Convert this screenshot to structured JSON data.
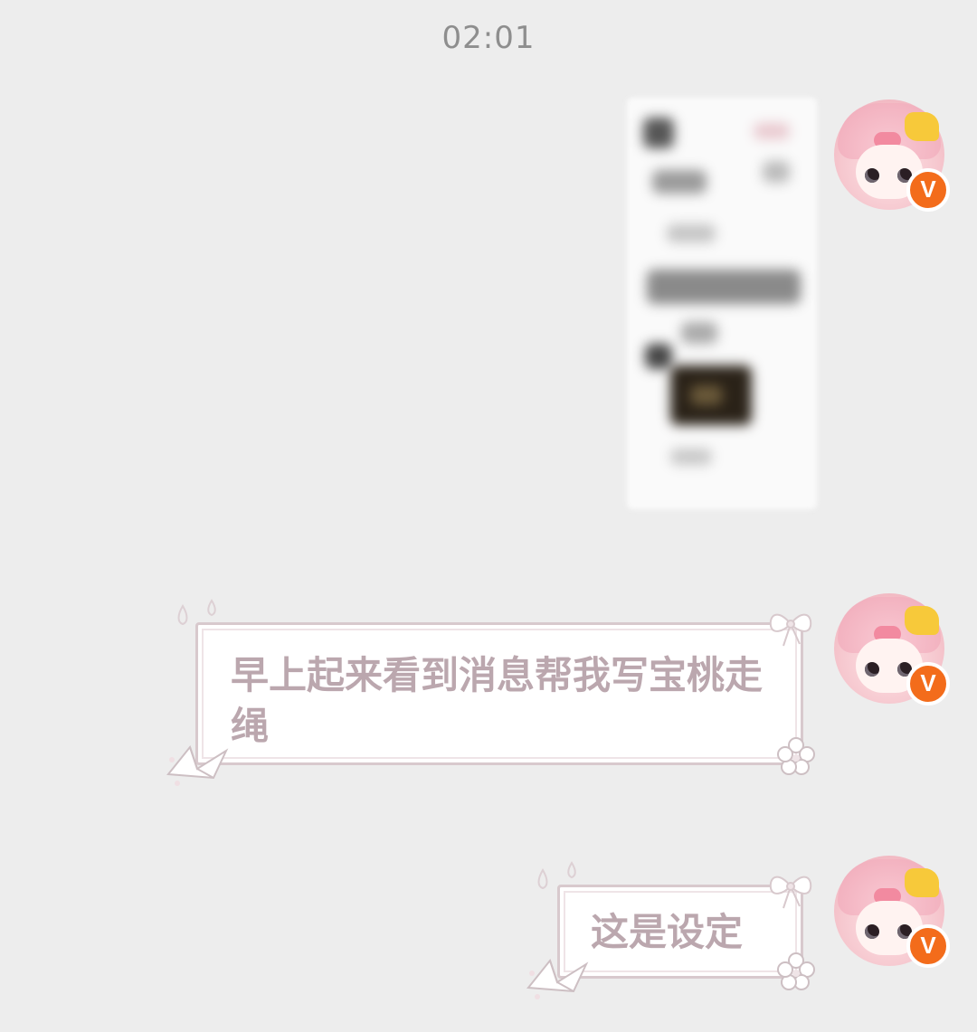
{
  "timestamp": "02:01",
  "messages": [
    {
      "type": "image",
      "content": "blurred-screenshot"
    },
    {
      "type": "text",
      "text": "早上起来看到消息帮我写宝桃走绳"
    },
    {
      "type": "text",
      "text": "这是设定"
    }
  ],
  "avatar": {
    "badge": "V",
    "accent": "#f36c1b"
  },
  "colors": {
    "background": "#ededed",
    "bubble_text": "#bba7ae",
    "bubble_border": "#d8c9cd"
  }
}
